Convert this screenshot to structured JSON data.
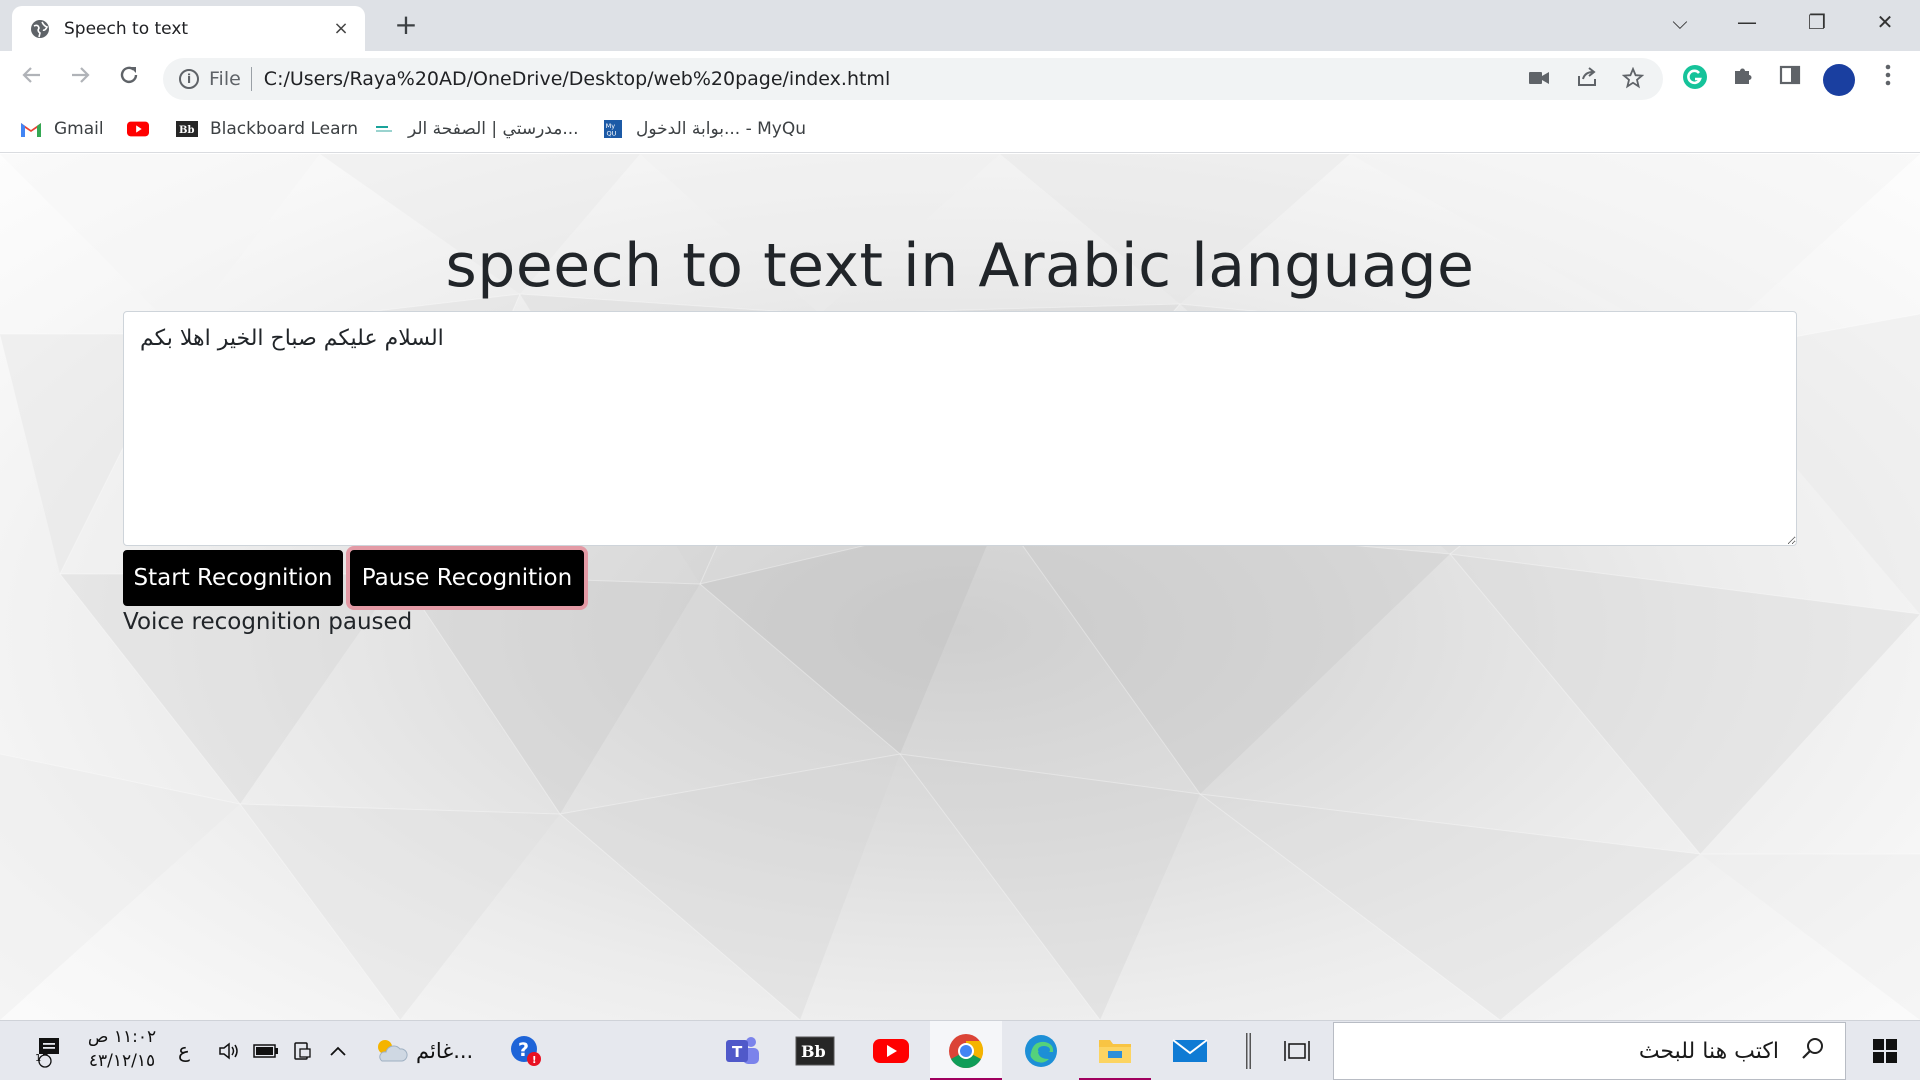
{
  "browser": {
    "tab": {
      "title": "Speech to text",
      "close_icon": "×"
    },
    "new_tab_icon": "+",
    "window_controls": {
      "tab_search": "⌵",
      "minimize": "—",
      "restore": "❐",
      "close": "✕"
    },
    "address": {
      "scheme": "File",
      "url": "C:/Users/Raya%20AD/OneDrive/Desktop/web%20page/index.html"
    },
    "bookmarks": [
      {
        "label": "Gmail",
        "icon": "gmail-icon"
      },
      {
        "label": "",
        "icon": "youtube-icon"
      },
      {
        "label": "Blackboard Learn",
        "icon": "blackboard-icon"
      },
      {
        "label": "مدرستي | الصفحة الر...",
        "icon": "madrasati-icon"
      },
      {
        "label": "بوابة الدخول... - MyQu",
        "icon": "myqu-icon"
      }
    ]
  },
  "page": {
    "title": "speech to text in Arabic language",
    "textarea_value": "السلام عليكم صباح الخير اهلا بكم",
    "start_button": "Start Recognition",
    "pause_button": "Pause Recognition",
    "status": "Voice recognition paused"
  },
  "taskbar": {
    "search_placeholder": "اكتب هنا للبحث",
    "time": "١١:٠٢ ص",
    "date": "٤٣/١٢/١٥",
    "input_language": "ع",
    "weather": "غائم...",
    "notification_count": "1",
    "accent_color": "#a0005f"
  },
  "colors": {
    "button_bg": "#000000",
    "focus_ring": "#e39aa5",
    "chrome_bg": "#dee1e6"
  }
}
